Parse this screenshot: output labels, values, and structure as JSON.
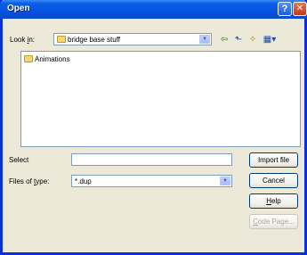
{
  "window": {
    "title": "Open"
  },
  "titlebar": {
    "help_glyph": "?",
    "close_glyph": "✕"
  },
  "lookin": {
    "label_pre": "Look ",
    "label_key": "i",
    "label_post": "n:",
    "value": "bridge base stuff"
  },
  "toolbar": {
    "back_glyph": "⇦",
    "up_glyph": "⬑",
    "newfolder_glyph": "✧",
    "view_glyph": "▦▾"
  },
  "files": [
    {
      "name": "Animations",
      "icon": "folder-icon"
    }
  ],
  "select": {
    "label": "Select",
    "value": ""
  },
  "filetype": {
    "label_pre": "Files of ",
    "label_key": "t",
    "label_post": "ype:",
    "value": "*.dup"
  },
  "buttons": {
    "import": "Import file",
    "cancel": "Cancel",
    "help_key": "H",
    "help_rest": "elp",
    "codepage_key": "C",
    "codepage_rest": "ode Page..."
  },
  "colors": {
    "title_blue": "#0553e3",
    "frame_blue": "#0831d9",
    "face": "#ece9d8"
  }
}
